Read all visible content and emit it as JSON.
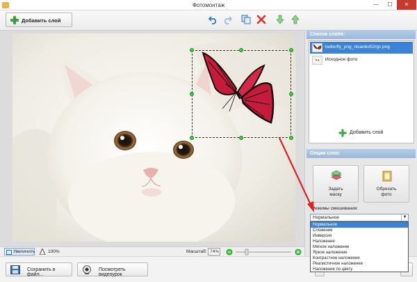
{
  "window": {
    "title": "Фотомонтаж",
    "min": "—",
    "max": "☐",
    "close": "✕"
  },
  "toolbar": {
    "add_layer_label": "Добавить слой",
    "icons": [
      "undo-icon",
      "redo-icon",
      "copy-icon",
      "delete-icon",
      "move-down-icon",
      "move-up-icon"
    ]
  },
  "bottombar": {
    "zoom_in_label": "Увеличить",
    "fit_label": "100%",
    "scale_label": "Масштаб:",
    "scale_value": "74%",
    "scale_level": 0.74
  },
  "footer": {
    "save_label": "Сохранить в файл...",
    "video_label": "Посмотреть видеоурок"
  },
  "layers_panel": {
    "header": "Список слоёв:",
    "items": [
      {
        "name": "butterfly_png_nisanbo52rgc.png",
        "selected": true
      },
      {
        "name": "Исходное фото",
        "selected": false
      }
    ],
    "add_layer_label": "Добавить слой"
  },
  "options_panel": {
    "header": "Опции слоя:",
    "mask_label_1": "Задать",
    "mask_label_2": "маску",
    "crop_label_1": "Обрезать",
    "crop_label_2": "фото",
    "blend_label": "Режимы смешивания:",
    "blend_selected": "Нормальное",
    "blend_options": [
      "Нормальное",
      "Сложение",
      "Инверсия",
      "Наложение",
      "Мягкое наложение",
      "Яркое наложение",
      "Контрастное наложение",
      "Реалистичное наложение",
      "Наложение по цвету"
    ]
  },
  "colors": {
    "accent": "#3c82d5",
    "handle": "#3bd03b",
    "annotation_arrow": "#e02020"
  }
}
